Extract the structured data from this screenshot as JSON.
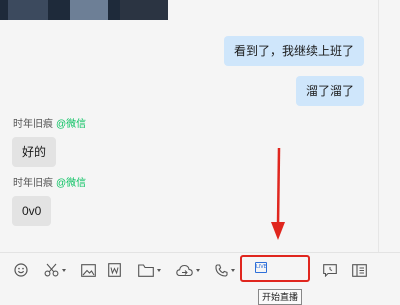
{
  "messages": {
    "out1": "看到了，我继续上班了",
    "out2": "溜了溜了",
    "in1": {
      "sender": "时年旧痕",
      "tag": "@微信",
      "text": "好的"
    },
    "in2": {
      "sender": "时年旧痕",
      "tag": "@微信",
      "text": "0v0"
    }
  },
  "toolbar": {
    "live_icon_text": "LIVE",
    "tooltip": "开始直播"
  },
  "colors": {
    "outgoing_bubble": "#cfe6fb",
    "incoming_bubble": "#e3e3e3",
    "wechat_tag": "#07c160",
    "annotation_red": "#e0261e"
  }
}
